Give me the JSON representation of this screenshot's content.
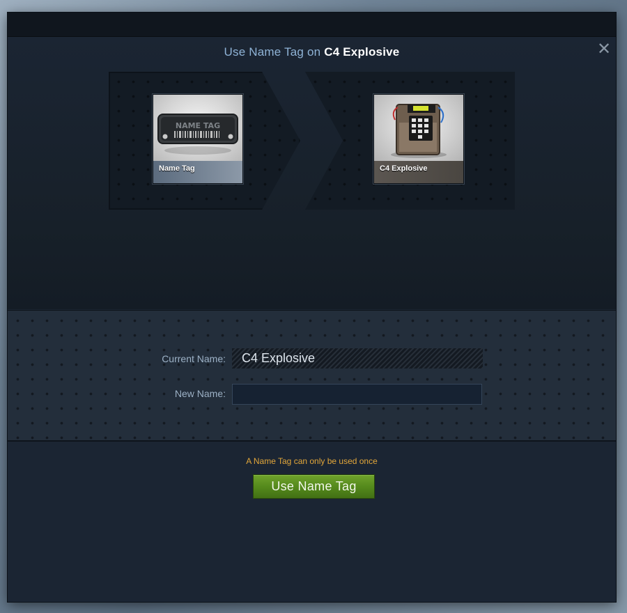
{
  "dialog": {
    "title_prefix": "Use Name Tag on ",
    "title_item": "C4 Explosive",
    "close_icon": "close-icon"
  },
  "tool_item": {
    "name": "Name Tag",
    "image_text": "NAME TAG"
  },
  "target_item": {
    "name": "C4 Explosive"
  },
  "form": {
    "current_name_label": "Current Name:",
    "current_name_value": "C4 Explosive",
    "new_name_label": "New Name:",
    "new_name_value": ""
  },
  "warning": "A Name Tag can only be used once",
  "button": {
    "label": "Use Name Tag"
  },
  "colors": {
    "accent_button": "#558a1c",
    "warning_text": "#e3a73a",
    "title_text": "#8fb3d6",
    "background": "#1a2431"
  }
}
